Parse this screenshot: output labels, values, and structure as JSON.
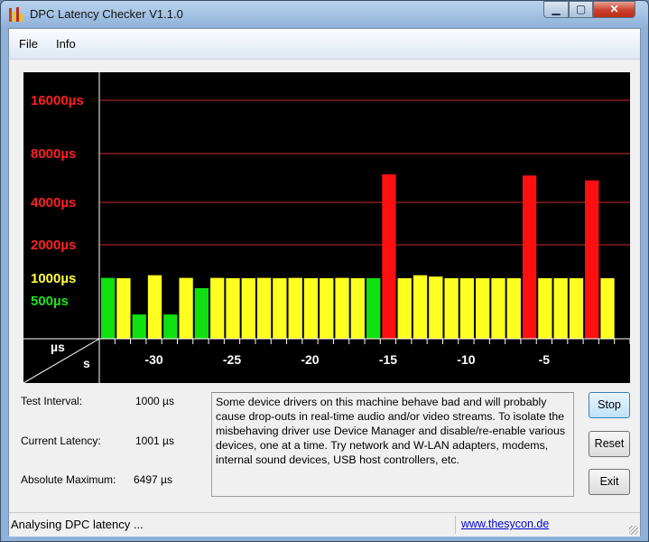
{
  "window": {
    "title": "DPC Latency Checker V1.1.0",
    "minimize": "▁",
    "maximize": "▢",
    "close": "✕"
  },
  "menu": {
    "file": "File",
    "info": "Info"
  },
  "chart_data": {
    "type": "bar",
    "y_labels": [
      {
        "text": "16000µs",
        "value": 16000,
        "color": "#ff2020"
      },
      {
        "text": "8000µs",
        "value": 8000,
        "color": "#ff2020"
      },
      {
        "text": "4000µs",
        "value": 4000,
        "color": "#ff2020"
      },
      {
        "text": "2000µs",
        "value": 2000,
        "color": "#ff2020"
      },
      {
        "text": "1000µs",
        "value": 1000,
        "color": "#ffff40"
      },
      {
        "text": "500µs",
        "value": 500,
        "color": "#20e020"
      }
    ],
    "axis_corner": {
      "y_unit": "µs",
      "x_unit": "s"
    },
    "x_ticks": [
      -30,
      -25,
      -20,
      -15,
      -10,
      -5
    ],
    "x_range": [
      -34,
      0
    ],
    "ylim": [
      0,
      23000
    ],
    "grid": true,
    "colors": {
      "green": "#10e010",
      "yellow": "#ffff20",
      "red": "#ff1010",
      "grid": "#cc2a2a"
    },
    "x": [
      -33,
      -32,
      -31,
      -30,
      -29,
      -28,
      -27,
      -26,
      -25,
      -24,
      -23,
      -22,
      -21,
      -20,
      -19,
      -18,
      -17,
      -16,
      -15,
      -14,
      -13,
      -12,
      -11,
      -10,
      -9,
      -8,
      -7,
      -6,
      -5,
      -4,
      -3,
      -2,
      -1
    ],
    "values": [
      1010,
      1000,
      320,
      1090,
      320,
      1010,
      780,
      1010,
      1000,
      1000,
      1010,
      1000,
      1010,
      1000,
      1000,
      1010,
      1000,
      1000,
      6300,
      1000,
      1090,
      1050,
      1000,
      1000,
      1000,
      1000,
      1000,
      6200,
      1000,
      1000,
      1000,
      5800,
      1000
    ],
    "value_colors": [
      "green",
      "yellow",
      "green",
      "yellow",
      "green",
      "yellow",
      "green",
      "yellow",
      "yellow",
      "yellow",
      "yellow",
      "yellow",
      "yellow",
      "yellow",
      "yellow",
      "yellow",
      "yellow",
      "green",
      "red",
      "yellow",
      "yellow",
      "yellow",
      "yellow",
      "yellow",
      "yellow",
      "yellow",
      "yellow",
      "red",
      "yellow",
      "yellow",
      "yellow",
      "red",
      "yellow"
    ]
  },
  "info": {
    "test_interval_label": "Test Interval:",
    "test_interval_value": "1000 µs",
    "current_latency_label": "Current Latency:",
    "current_latency_value": "1001 µs",
    "absolute_maximum_label": "Absolute Maximum:",
    "absolute_maximum_value": "6497 µs"
  },
  "message": "Some device drivers on this machine behave bad and will probably cause drop-outs in real-time audio and/or video streams. To isolate the misbehaving driver use Device Manager and disable/re-enable various devices, one at a time. Try network and W-LAN adapters, modems, internal sound devices, USB host controllers, etc.",
  "buttons": {
    "stop": "Stop",
    "reset": "Reset",
    "exit": "Exit"
  },
  "status": {
    "text": "Analysing DPC latency ...",
    "link": "www.thesycon.de"
  }
}
